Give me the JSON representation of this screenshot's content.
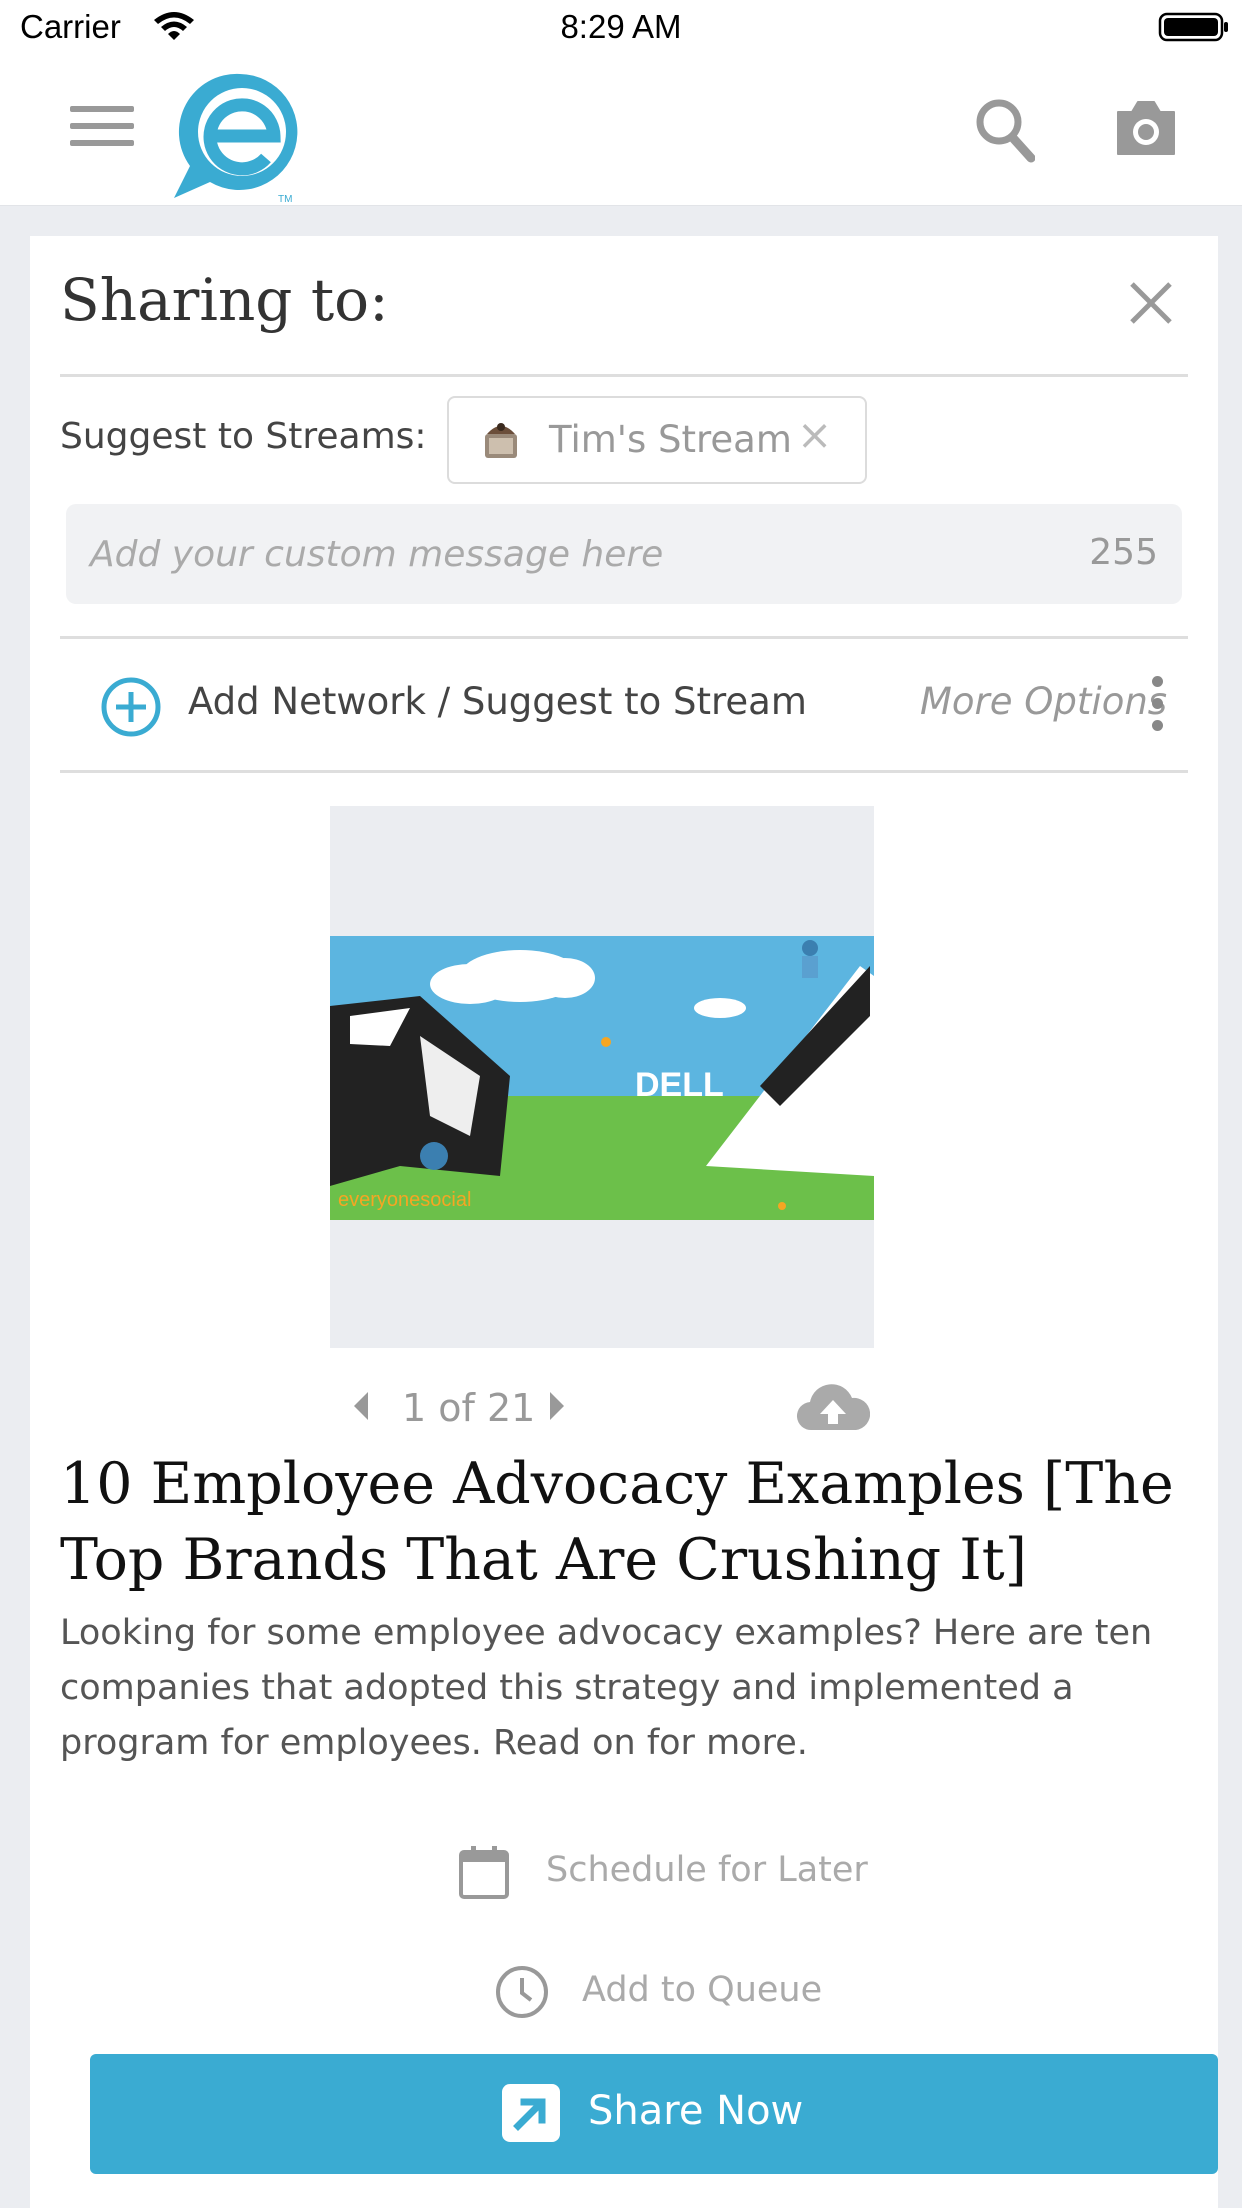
{
  "status_bar": {
    "carrier": "Carrier",
    "time": "8:29 AM"
  },
  "nav": {
    "menu_icon": "hamburger-icon",
    "logo_icon": "everyonesocial-logo",
    "search_icon": "search-icon",
    "camera_icon": "camera-icon",
    "brand_color": "#3aabd2"
  },
  "sharing": {
    "title": "Sharing to:",
    "close_icon": "close-icon",
    "suggest_label": "Suggest to Streams:",
    "stream_chip": {
      "name": "Tim's Stream",
      "remove": "×"
    },
    "message_placeholder": "Add your custom message here",
    "char_count": "255",
    "add_network_label": "Add Network / Suggest to Stream",
    "more_options_label": "More Options"
  },
  "article": {
    "image_brand_text": "DELL",
    "image_watermark": "everyonesocial",
    "pager": "1 of 21",
    "title": "10 Employee Advocacy Examples [The Top Brands That Are Crushing It]",
    "description": "Looking for some employee advocacy examples? Here are ten companies that adopted this strategy and implemented a program for employees. Read on for more."
  },
  "actions": {
    "schedule_label": "Schedule for Later",
    "queue_label": "Add to Queue",
    "share_label": "Share Now"
  }
}
